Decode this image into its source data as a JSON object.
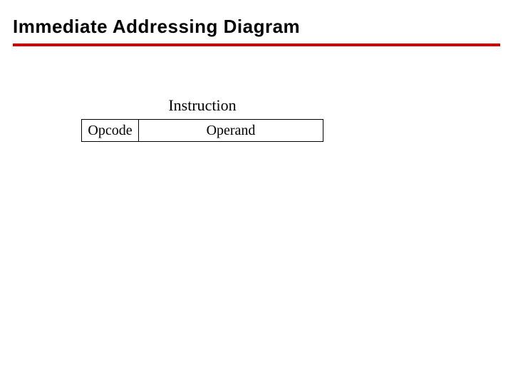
{
  "title": "Immediate Addressing Diagram",
  "diagram": {
    "instruction_label": "Instruction",
    "opcode_label": "Opcode",
    "operand_label": "Operand"
  },
  "colors": {
    "underline": "#d90000"
  }
}
